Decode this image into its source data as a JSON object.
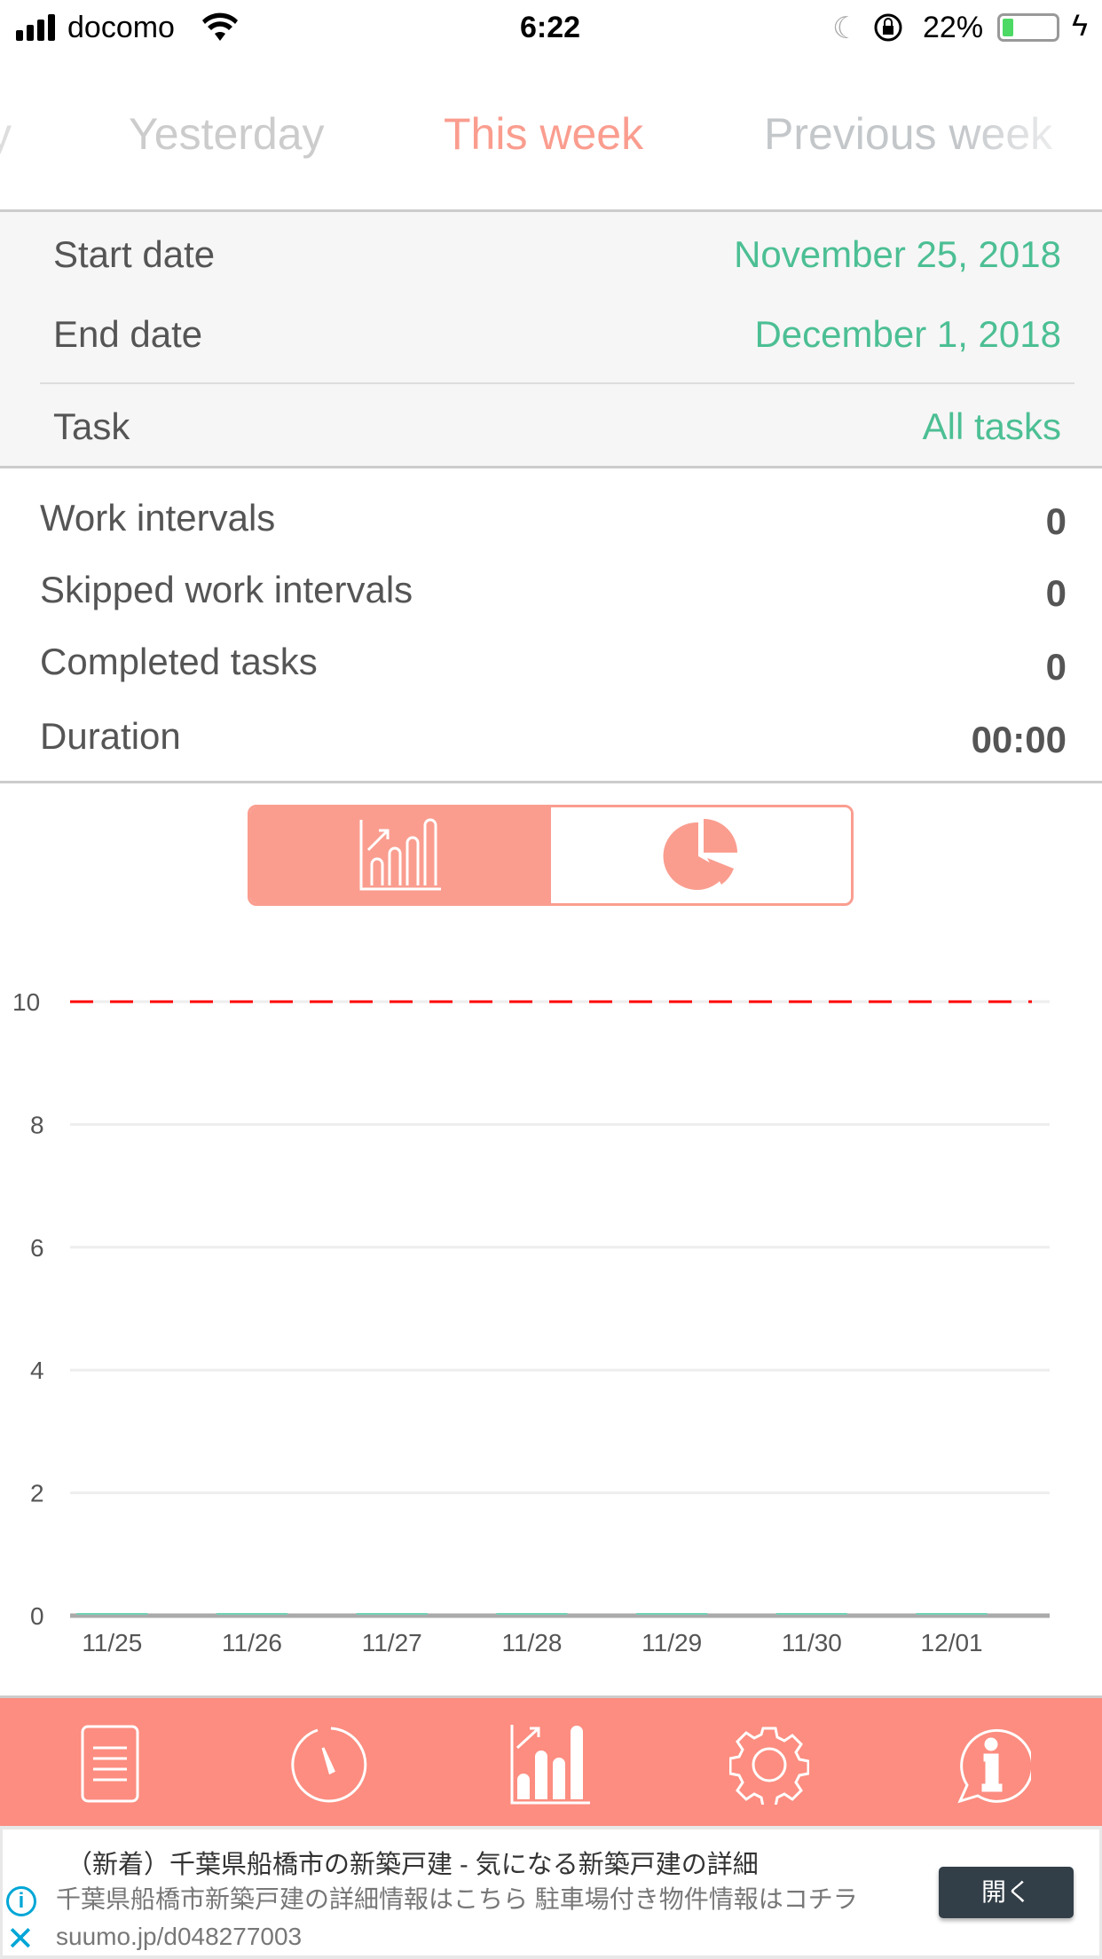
{
  "status_bar": {
    "carrier": "docomo",
    "time": "6:22",
    "battery": "22%",
    "battery_level": 0.22,
    "battery_color": "#4cd964"
  },
  "period_tabs": [
    {
      "label": "y"
    },
    {
      "label": "Yesterday"
    },
    {
      "label": "This week",
      "active": true
    },
    {
      "label": "Previous week"
    }
  ],
  "accent": "#fa9d8f",
  "value_color": "#4cbf94",
  "filters": {
    "start_label": "Start date",
    "start_value": "November 25, 2018",
    "end_label": "End date",
    "end_value": "December 1, 2018",
    "task_label": "Task",
    "task_value": "All tasks"
  },
  "stats": [
    {
      "label": "Work intervals",
      "value": "0"
    },
    {
      "label": "Skipped work intervals",
      "value": "0"
    },
    {
      "label": "Completed tasks",
      "value": "0"
    },
    {
      "label": "Duration",
      "value": "00:00"
    }
  ],
  "chart_toggle": {
    "selected": "bar-chart",
    "options": [
      "bar-chart-icon",
      "pie-chart-icon"
    ]
  },
  "chart_data": {
    "type": "bar",
    "categories": [
      "11/25",
      "11/26",
      "11/27",
      "11/28",
      "11/29",
      "11/30",
      "12/01"
    ],
    "values": [
      0,
      0,
      0,
      0,
      0,
      0,
      0
    ],
    "yticks": [
      "0",
      "2",
      "4",
      "6",
      "8",
      "10"
    ],
    "ylim": [
      0,
      10
    ],
    "goal_line": 10,
    "goal_color": "#ff0000",
    "bar_color": "#6fd3b5",
    "grid": true
  },
  "tab_bar": [
    "tasks-icon",
    "timer-icon",
    "statistics-icon",
    "settings-icon",
    "info-icon"
  ],
  "ad": {
    "title": "（新着）千葉県船橋市の新築戸建 - 気になる新築戸建の詳細",
    "body": "千葉県船橋市新築戸建の詳細情報はこちら 駐車場付き物件情報はコチラ suumo.jp/d048277003",
    "button": "開く"
  }
}
